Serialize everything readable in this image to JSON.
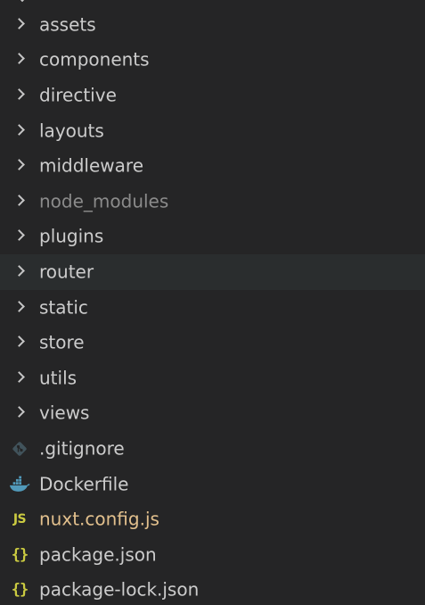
{
  "explorer": {
    "folders": [
      {
        "label": "assets"
      },
      {
        "label": "components"
      },
      {
        "label": "directive"
      },
      {
        "label": "layouts"
      },
      {
        "label": "middleware"
      },
      {
        "label": "node_modules"
      },
      {
        "label": "plugins"
      },
      {
        "label": "router"
      },
      {
        "label": "static"
      },
      {
        "label": "store"
      },
      {
        "label": "utils"
      },
      {
        "label": "views"
      }
    ],
    "files": [
      {
        "label": ".gitignore",
        "icon": "git-icon"
      },
      {
        "label": "Dockerfile",
        "icon": "docker-icon"
      },
      {
        "label": "nuxt.config.js",
        "icon": "javascript-icon",
        "badge": "JS"
      },
      {
        "label": "package.json",
        "icon": "json-icon",
        "badge": "{}"
      },
      {
        "label": "package-lock.json",
        "icon": "json-icon",
        "badge": "{}"
      }
    ],
    "colors": {
      "background": "#252526",
      "hover_row": "#2a2d2e",
      "text": "#cccccc",
      "ignored_text": "#8b8b8b",
      "modified_text": "#e2c08d",
      "js_badge": "#cbcb41",
      "json_badge": "#cbcb41",
      "docker_blue": "#519aba",
      "git_icon": "#41535b"
    }
  }
}
